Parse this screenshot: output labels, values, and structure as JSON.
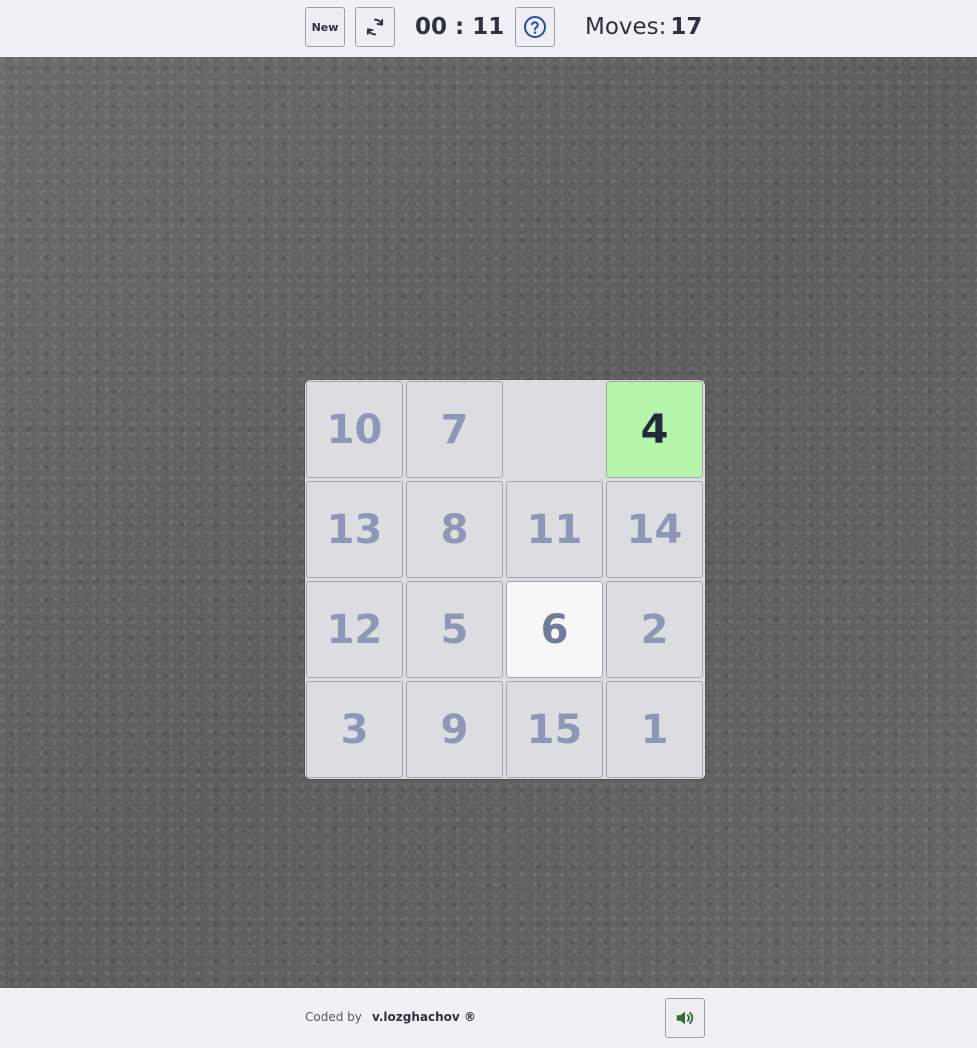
{
  "toolbar": {
    "new_label": "New",
    "timer": "00 : 11",
    "moves_label": "Moves:",
    "moves_count": "17"
  },
  "board": {
    "tiles": [
      "10",
      "7",
      "",
      "4",
      "13",
      "8",
      "11",
      "14",
      "12",
      "5",
      "6",
      "2",
      "3",
      "9",
      "15",
      "1"
    ]
  },
  "footer": {
    "coded_by": "Coded by",
    "author": "v.lozghachov ®"
  },
  "colors": {
    "correct_tile": "#b5f5aa",
    "active_tile": "#f7f7f8",
    "tile": "#dcdde0",
    "tile_text": "#8e97b6",
    "accent": "#2a4aa8"
  },
  "icons": {
    "restart": "refresh-icon",
    "help": "question-circle-icon",
    "sound": "speaker-icon"
  }
}
